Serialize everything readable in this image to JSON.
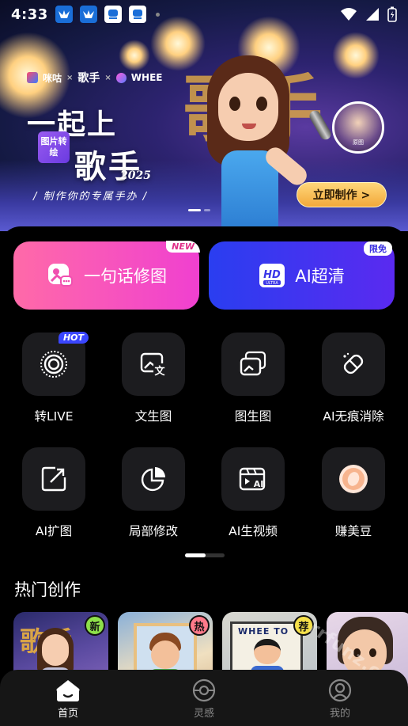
{
  "status_bar": {
    "time": "4:33"
  },
  "banner": {
    "brand_primary": "咪咕",
    "brand_secondary": "WHEE",
    "tag": "图片转绘",
    "headline_line1": "一起上",
    "headline_line2": "歌手",
    "year": "2025",
    "subline": "/ 制作你的专属手办 /",
    "cta": "立即制作 >",
    "avatar_label": "原图",
    "slide_count": 2,
    "active_slide": 1
  },
  "primary_actions": [
    {
      "label": "一句话修图",
      "badge": "NEW",
      "icon": "photo-edit-icon"
    },
    {
      "label": "AI超清",
      "badge": "限免",
      "icon": "hd-ultra-icon"
    }
  ],
  "tools": [
    {
      "label": "转LIVE",
      "icon": "live-photo-icon",
      "badge": "HOT"
    },
    {
      "label": "文生图",
      "icon": "text-to-image-icon"
    },
    {
      "label": "图生图",
      "icon": "image-to-image-icon"
    },
    {
      "label": "AI无痕消除",
      "icon": "eraser-icon"
    },
    {
      "label": "AI扩图",
      "icon": "expand-image-icon"
    },
    {
      "label": "局部修改",
      "icon": "partial-edit-icon"
    },
    {
      "label": "AI生视频",
      "icon": "ai-video-icon"
    },
    {
      "label": "赚美豆",
      "icon": "bean-coin-icon"
    }
  ],
  "section": {
    "title": "热门创作"
  },
  "cards": [
    {
      "badge": "新",
      "badge_color": "#8ee04a"
    },
    {
      "badge": "热",
      "badge_color": "#ff7a8a"
    },
    {
      "badge": "荐",
      "badge_color": "#f5e04a"
    },
    {
      "badge": ""
    }
  ],
  "bottom_nav": [
    {
      "label": "首页",
      "icon": "home-icon",
      "active": true
    },
    {
      "label": "灵感",
      "icon": "inspiration-icon",
      "active": false
    },
    {
      "label": "我的",
      "icon": "profile-icon",
      "active": false
    }
  ],
  "watermark": "rrfunz.com"
}
